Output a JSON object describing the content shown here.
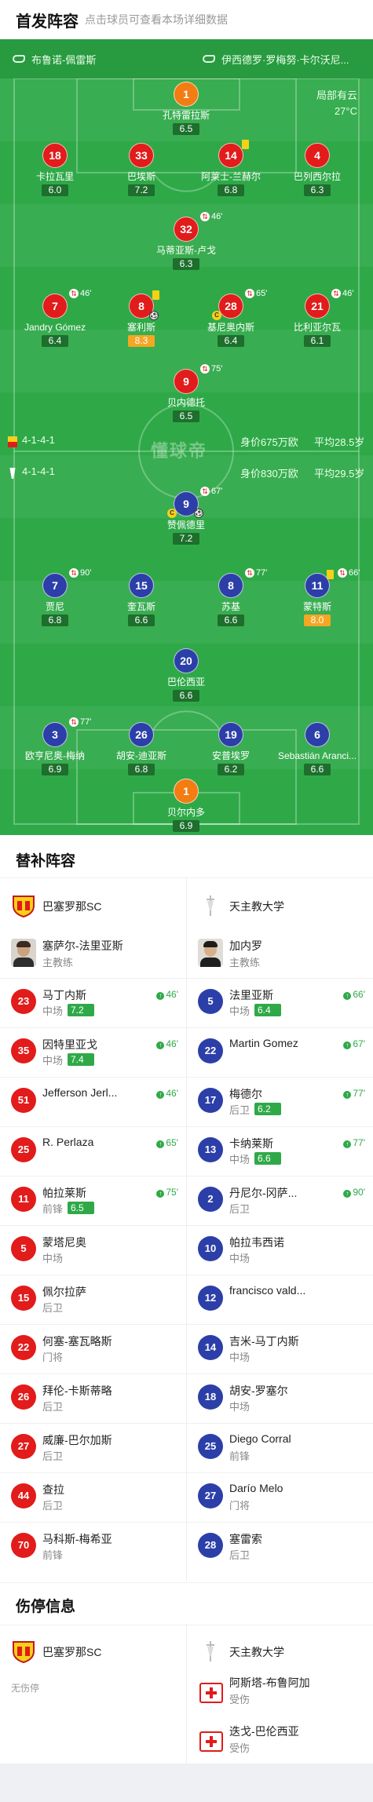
{
  "header": {
    "title": "首发阵容",
    "subtitle": "点击球员可查看本场详细数据"
  },
  "coaches": {
    "home": "布鲁诺-佩雷斯",
    "away": "伊西德罗·罗梅努·卡尔沃尼..."
  },
  "weather": {
    "condition": "局部有云",
    "temp": "27°C"
  },
  "home_team": {
    "formation": "4-1-4-1",
    "value": "身价675万欧",
    "avg_age": "平均28.5岁"
  },
  "away_team": {
    "formation": "4-1-4-1",
    "value": "身价830万欧",
    "avg_age": "平均29.5岁"
  },
  "watermark": "懂球帝",
  "pitch_players": {
    "p1": {
      "num": "1",
      "name": "孔特雷拉斯",
      "rating": "6.5"
    },
    "p2": {
      "num": "18",
      "name": "卡拉瓦里",
      "rating": "6.0"
    },
    "p3": {
      "num": "33",
      "name": "巴埃斯",
      "rating": "7.2"
    },
    "p4": {
      "num": "14",
      "name": "阿莱士-兰赫尔",
      "rating": "6.8"
    },
    "p5": {
      "num": "4",
      "name": "巴列西尔拉",
      "rating": "6.3"
    },
    "p6": {
      "num": "32",
      "name": "马蒂亚斯-卢戈",
      "rating": "6.3",
      "sub": "46'"
    },
    "p7": {
      "num": "7",
      "name": "Jandry Gómez",
      "rating": "6.4",
      "sub": "46'"
    },
    "p8": {
      "num": "8",
      "name": "塞利斯",
      "rating": "8.3"
    },
    "p9": {
      "num": "28",
      "name": "基尼奥内斯",
      "rating": "6.4",
      "sub": "65'"
    },
    "p10": {
      "num": "21",
      "name": "比利亚尔瓦",
      "rating": "6.1",
      "sub": "46'"
    },
    "p11": {
      "num": "9",
      "name": "贝内德托",
      "rating": "6.5",
      "sub": "75'"
    },
    "a1": {
      "num": "9",
      "name": "赞佩德里",
      "rating": "7.2",
      "sub": "67'"
    },
    "a2": {
      "num": "7",
      "name": "贾尼",
      "rating": "6.8",
      "sub": "90'"
    },
    "a3": {
      "num": "15",
      "name": "奎瓦斯",
      "rating": "6.6"
    },
    "a4": {
      "num": "8",
      "name": "苏基",
      "rating": "6.6",
      "sub": "77'"
    },
    "a5": {
      "num": "11",
      "name": "蒙特斯",
      "rating": "8.0",
      "sub": "66'"
    },
    "a6": {
      "num": "20",
      "name": "巴伦西亚",
      "rating": "6.6"
    },
    "a7": {
      "num": "3",
      "name": "欧亨尼奥-梅纳",
      "rating": "6.9",
      "sub": "77'"
    },
    "a8": {
      "num": "26",
      "name": "胡安-迪亚斯",
      "rating": "6.8"
    },
    "a9": {
      "num": "19",
      "name": "安普埃罗",
      "rating": "6.2"
    },
    "a10": {
      "num": "6",
      "name": "Sebastián Aranci...",
      "rating": "6.6"
    },
    "a11": {
      "num": "1",
      "name": "贝尔内多",
      "rating": "6.9"
    }
  },
  "subs": {
    "title": "替补阵容",
    "home_club": "巴塞罗那SC",
    "away_club": "天主教大学",
    "home_coach": {
      "name": "塞萨尔-法里亚斯",
      "role": "主教练"
    },
    "away_coach": {
      "name": "加内罗",
      "role": "主教练"
    },
    "home": [
      {
        "num": "23",
        "name": "马丁内斯",
        "pos": "中场",
        "rating": "7.2",
        "in": "46'"
      },
      {
        "num": "35",
        "name": "因特里亚戈",
        "pos": "中场",
        "rating": "7.4",
        "in": "46'"
      },
      {
        "num": "51",
        "name": "Jefferson Jerl...",
        "pos": "",
        "rating": "",
        "in": "46'"
      },
      {
        "num": "25",
        "name": "R. Perlaza",
        "pos": "",
        "rating": "",
        "in": "65'"
      },
      {
        "num": "11",
        "name": "帕拉莱斯",
        "pos": "前锋",
        "rating": "6.5",
        "in": "75'"
      },
      {
        "num": "5",
        "name": "蒙塔尼奥",
        "pos": "中场",
        "rating": "",
        "in": ""
      },
      {
        "num": "15",
        "name": "佩尔拉萨",
        "pos": "后卫",
        "rating": "",
        "in": ""
      },
      {
        "num": "22",
        "name": "何塞-塞瓦略斯",
        "pos": "门将",
        "rating": "",
        "in": ""
      },
      {
        "num": "26",
        "name": "拜伦-卡斯蒂略",
        "pos": "后卫",
        "rating": "",
        "in": ""
      },
      {
        "num": "27",
        "name": "威廉-巴尔加斯",
        "pos": "后卫",
        "rating": "",
        "in": ""
      },
      {
        "num": "44",
        "name": "查拉",
        "pos": "后卫",
        "rating": "",
        "in": ""
      },
      {
        "num": "70",
        "name": "马科斯-梅希亚",
        "pos": "前锋",
        "rating": "",
        "in": ""
      }
    ],
    "away": [
      {
        "num": "5",
        "name": "法里亚斯",
        "pos": "中场",
        "rating": "6.4",
        "in": "66'"
      },
      {
        "num": "22",
        "name": "Martin Gomez",
        "pos": "",
        "rating": "",
        "in": "67'"
      },
      {
        "num": "17",
        "name": "梅德尔",
        "pos": "后卫",
        "rating": "6.2",
        "in": "77'"
      },
      {
        "num": "13",
        "name": "卡纳莱斯",
        "pos": "中场",
        "rating": "6.6",
        "in": "77'"
      },
      {
        "num": "2",
        "name": "丹尼尔-冈萨...",
        "pos": "后卫",
        "rating": "",
        "in": "90'"
      },
      {
        "num": "10",
        "name": "帕拉韦西诺",
        "pos": "中场",
        "rating": "",
        "in": ""
      },
      {
        "num": "12",
        "name": "francisco vald...",
        "pos": "",
        "rating": "",
        "in": ""
      },
      {
        "num": "14",
        "name": "吉米-马丁内斯",
        "pos": "中场",
        "rating": "",
        "in": ""
      },
      {
        "num": "18",
        "name": "胡安-罗塞尔",
        "pos": "中场",
        "rating": "",
        "in": ""
      },
      {
        "num": "25",
        "name": "Diego Corral",
        "pos": "前锋",
        "rating": "",
        "in": ""
      },
      {
        "num": "27",
        "name": "Darío Melo",
        "pos": "门将",
        "rating": "",
        "in": ""
      },
      {
        "num": "28",
        "name": "塞雷索",
        "pos": "后卫",
        "rating": "",
        "in": ""
      }
    ]
  },
  "injuries": {
    "title": "伤停信息",
    "home_club": "巴塞罗那SC",
    "away_club": "天主教大学",
    "home_none": "无伤停",
    "away": [
      {
        "name": "阿斯塔-布鲁阿加",
        "status": "受伤"
      },
      {
        "name": "迭戈-巴伦西亚",
        "status": "受伤"
      }
    ]
  }
}
